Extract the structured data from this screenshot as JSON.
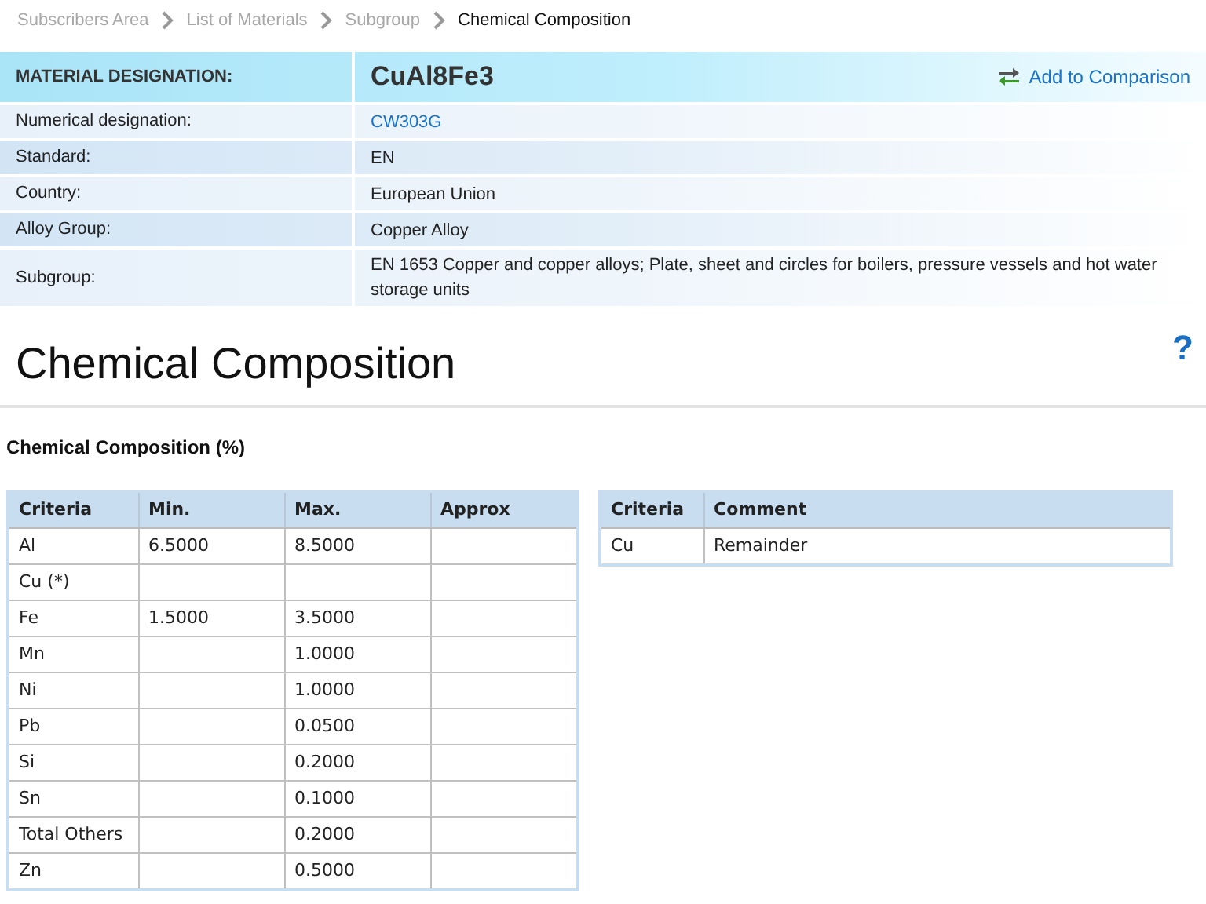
{
  "breadcrumb": [
    {
      "label": "Subscribers Area",
      "current": false
    },
    {
      "label": "List of Materials",
      "current": false
    },
    {
      "label": "Subgroup",
      "current": false
    },
    {
      "label": "Chemical Composition",
      "current": true
    }
  ],
  "material": {
    "label": "MATERIAL DESIGNATION:",
    "value": "CuAl8Fe3",
    "compare_link": "Add to Comparison"
  },
  "info_rows": [
    {
      "label": "Numerical designation:",
      "value": "CW303G",
      "kind": "link"
    },
    {
      "label": "Standard:",
      "value": "EN",
      "kind": "text"
    },
    {
      "label": "Country:",
      "value": "European Union",
      "kind": "text"
    },
    {
      "label": "Alloy Group:",
      "value": "Copper Alloy",
      "kind": "text"
    },
    {
      "label": "Subgroup:",
      "value": "EN 1653 Copper and copper alloys; Plate, sheet and circles for boilers, pressure vessels and hot water storage units",
      "kind": "text"
    }
  ],
  "page_title": "Chemical Composition",
  "help": "?",
  "section_title": "Chemical Composition (%)",
  "composition_table": {
    "columns": [
      "Criteria",
      "Min.",
      "Max.",
      "Approx"
    ],
    "rows": [
      {
        "criteria": "Al",
        "min": "6.5000",
        "max": "8.5000"
      },
      {
        "criteria": "Cu (*)"
      },
      {
        "criteria": "Fe",
        "min": "1.5000",
        "max": "3.5000"
      },
      {
        "criteria": "Mn",
        "max": "1.0000"
      },
      {
        "criteria": "Ni",
        "max": "1.0000"
      },
      {
        "criteria": "Pb",
        "max": "0.0500"
      },
      {
        "criteria": "Si",
        "max": "0.2000"
      },
      {
        "criteria": "Sn",
        "max": "0.1000"
      },
      {
        "criteria": "Total Others",
        "max": "0.2000"
      },
      {
        "criteria": "Zn",
        "max": "0.5000"
      }
    ]
  },
  "comment_table": {
    "columns": [
      "Criteria",
      "Comment"
    ],
    "rows": [
      {
        "criteria": "Cu",
        "comment": "Remainder"
      }
    ]
  }
}
